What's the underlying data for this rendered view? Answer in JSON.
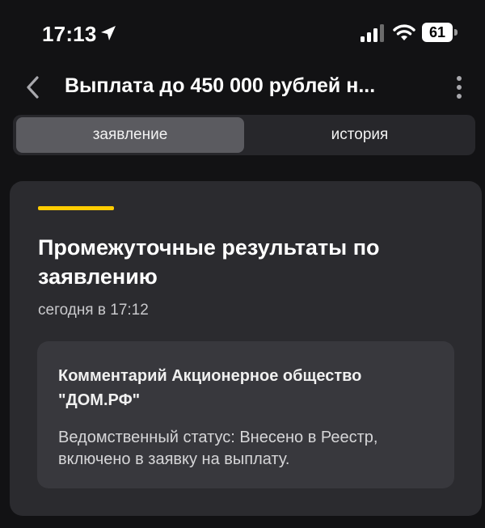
{
  "status_bar": {
    "time": "17:13",
    "battery_level": "61",
    "icons": [
      "location-arrow-icon",
      "cellular-signal-icon",
      "wifi-icon",
      "battery-icon"
    ]
  },
  "nav": {
    "title": "Выплата до 450 000 рублей н...",
    "back_icon": "chevron-left-icon",
    "more_icon": "more-vertical-icon"
  },
  "tabs": [
    {
      "label": "заявление",
      "active": true
    },
    {
      "label": "история",
      "active": false
    }
  ],
  "card": {
    "title": "Промежуточные результаты по заявлению",
    "date": "сегодня в 17:12",
    "comment": {
      "title": "Комментарий Акционерное общество \"ДОМ.РФ\"",
      "text": "Ведомственный статус: Внесено в Реестр, включено в заявку на выплату."
    }
  },
  "colors": {
    "background": "#121214",
    "card": "#2b2b2f",
    "comment_box": "#38383d",
    "accent": "#ffcc00",
    "segment_active": "#5b5b60"
  }
}
